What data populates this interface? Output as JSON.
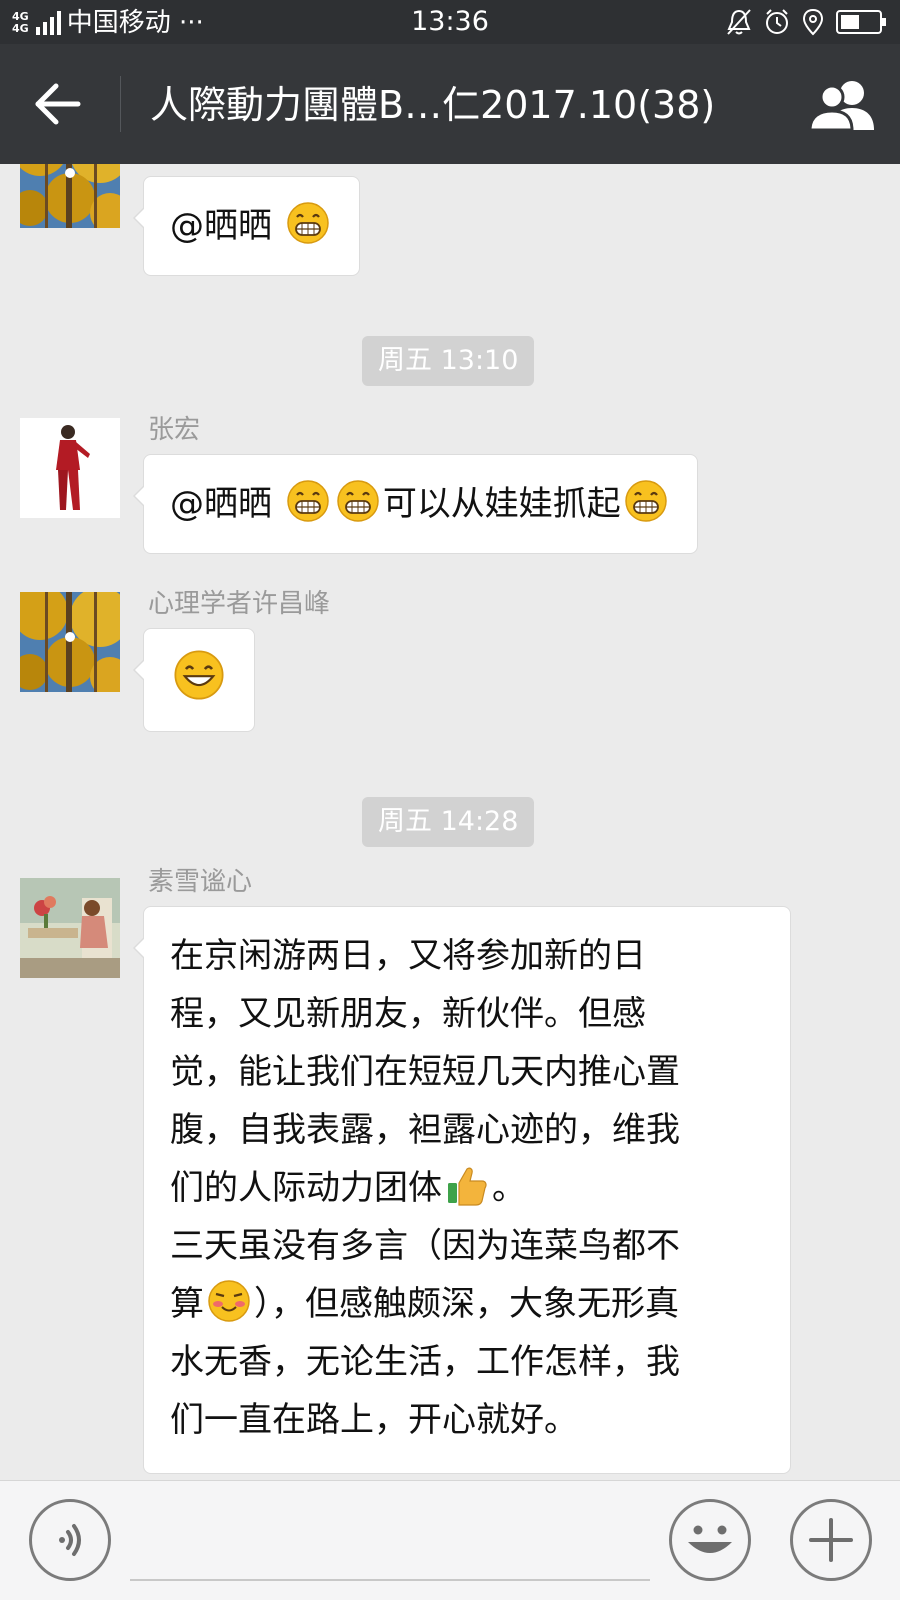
{
  "status_bar": {
    "network": "4G 4G",
    "carrier": "中国移动 ···",
    "time": "13:36"
  },
  "header": {
    "title": "人際動力團體B…仁2017.10(38)"
  },
  "messages": [
    {
      "sender": "",
      "text": "@晒晒",
      "emoji_after": [
        "grin-emoji"
      ]
    },
    {
      "timestamp": "周五 13:10"
    },
    {
      "sender": "张宏",
      "text_parts": [
        "@晒晒",
        "可以从娃娃抓起"
      ],
      "emojis": [
        "grin-emoji",
        "grin-emoji",
        "grin-emoji"
      ]
    },
    {
      "sender": "心理学者许昌峰",
      "emoji_only": "smile-emoji"
    },
    {
      "timestamp": "周五 14:28"
    },
    {
      "sender": "素雪谧心",
      "lines": [
        "在京闲游两日，又将参加新的日",
        "程，又见新朋友，新伙伴。但感",
        "觉，能让我们在短短几天内推心置",
        "腹，自我表露，袒露心迹的，维我",
        "们的人际动力团体",
        "。",
        "三天虽没有多言（因为连菜鸟都不",
        "算",
        "），但感触颇深，大象无形真",
        "水无香，无论生活，工作怎样，我",
        "们一直在路上，开心就好。"
      ],
      "inline_emojis": [
        "thumbs-up-emoji",
        "shy-smile-emoji"
      ]
    }
  ],
  "colors": {
    "nav_bg": "#35373a",
    "status_bg": "#2e3033",
    "chat_bg": "#ebebeb",
    "bubble_bg": "#ffffff",
    "time_chip_bg": "#d2d2d2",
    "name_text": "#9a9a9a"
  }
}
